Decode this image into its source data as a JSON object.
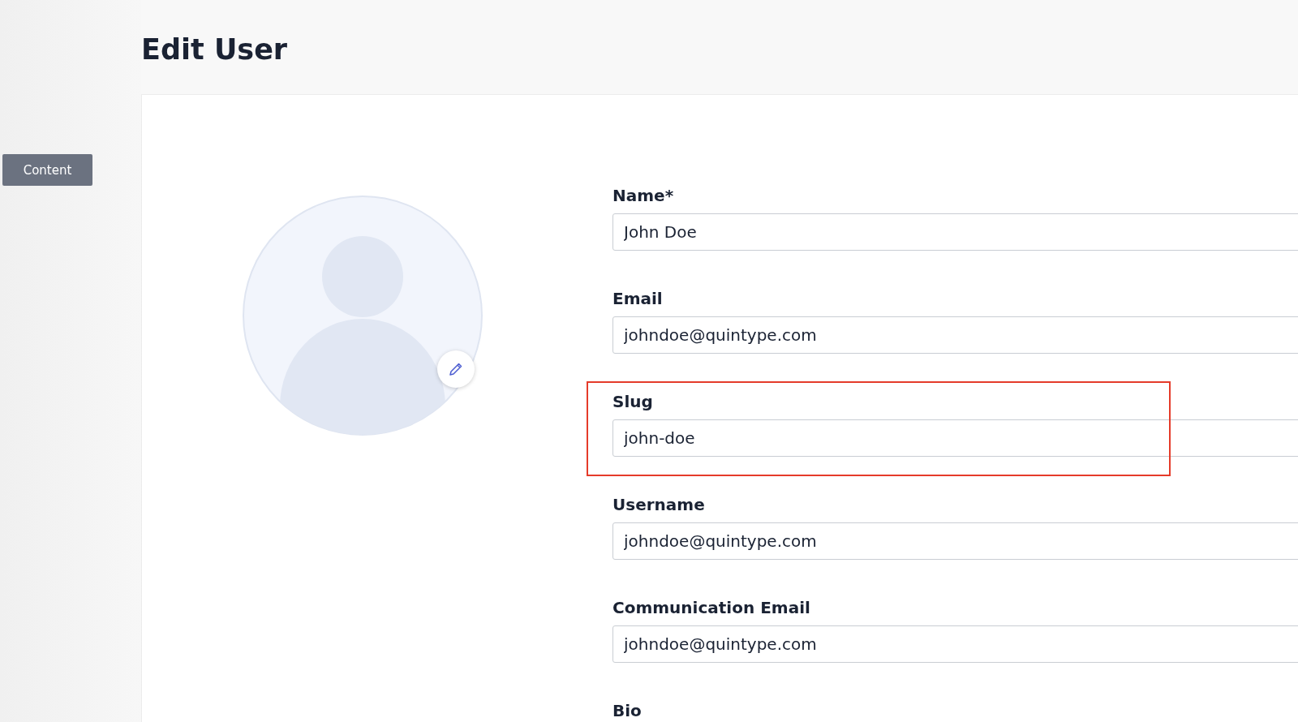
{
  "page": {
    "title": "Edit User"
  },
  "sidebar": {
    "items": [
      {
        "label": "Content"
      }
    ]
  },
  "fields": [
    {
      "label": "Name*",
      "value": "John Doe",
      "highlighted": false
    },
    {
      "label": "Email",
      "value": "johndoe@quintype.com",
      "highlighted": false
    },
    {
      "label": "Slug",
      "value": "john-doe",
      "highlighted": true
    },
    {
      "label": "Username",
      "value": "johndoe@quintype.com",
      "highlighted": false
    },
    {
      "label": "Communication Email",
      "value": "johndoe@quintype.com",
      "highlighted": false
    },
    {
      "label": "Bio",
      "highlighted": false
    }
  ]
}
